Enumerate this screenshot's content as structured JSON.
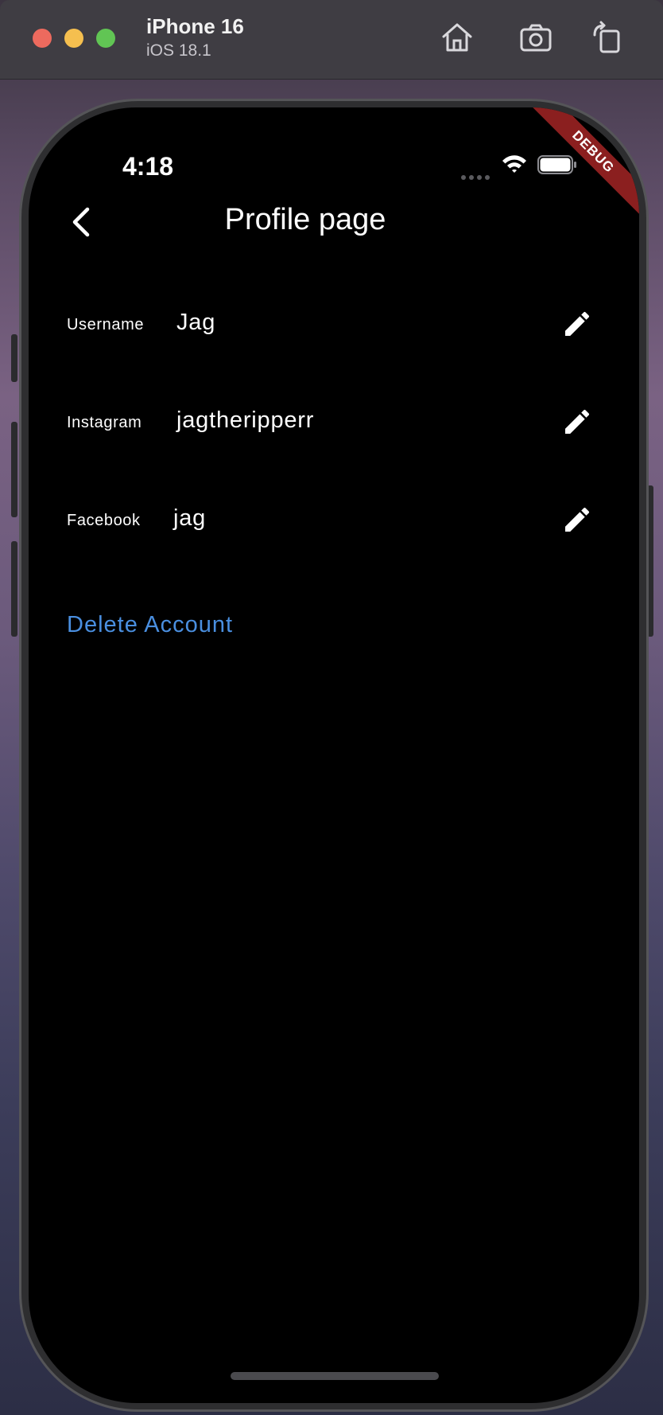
{
  "simulator": {
    "device_name": "iPhone 16",
    "os_version": "iOS 18.1",
    "toolbar_icons": [
      "home-icon",
      "screenshot-icon",
      "rotate-icon"
    ]
  },
  "status_bar": {
    "time": "4:18",
    "icons": [
      "signal-dots-icon",
      "wifi-icon",
      "battery-icon"
    ]
  },
  "debug_banner": "DEBUG",
  "app_bar": {
    "back_icon": "chevron-left-icon",
    "title": "Profile page"
  },
  "fields": [
    {
      "label": "Username",
      "value": "Jag",
      "edit_icon": "pencil-icon"
    },
    {
      "label": "Instagram",
      "value": "jagtheripperr",
      "edit_icon": "pencil-icon"
    },
    {
      "label": "Facebook",
      "value": "jag",
      "edit_icon": "pencil-icon"
    }
  ],
  "actions": {
    "delete_account": "Delete Account"
  },
  "colors": {
    "screen_background": "#000000",
    "text": "#ffffff",
    "link": "#4a8fe0",
    "debug_banner": "#8b1f1f"
  }
}
